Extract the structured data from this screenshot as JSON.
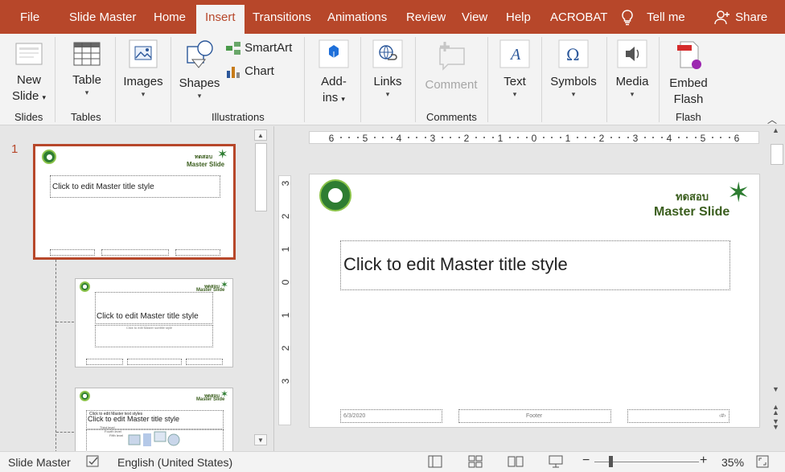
{
  "tabs": {
    "file": "File",
    "slide_master": "Slide Master",
    "home": "Home",
    "insert": "Insert",
    "transitions": "Transitions",
    "animations": "Animations",
    "review": "Review",
    "view": "View",
    "help": "Help",
    "acrobat": "ACROBAT",
    "tell_me": "Tell me",
    "share": "Share"
  },
  "ribbon": {
    "new_slide": "New",
    "new_slide2": "Slide",
    "table": "Table",
    "images": "Images",
    "shapes": "Shapes",
    "smartart": "SmartArt",
    "chart": "Chart",
    "addins": "Add-",
    "addins2": "ins",
    "links": "Links",
    "comment": "Comment",
    "text": "Text",
    "symbols": "Symbols",
    "media": "Media",
    "embed_flash": "Embed",
    "embed_flash2": "Flash",
    "groups": {
      "slides": "Slides",
      "tables": "Tables",
      "illustrations": "Illustrations",
      "comments": "Comments",
      "flash": "Flash"
    }
  },
  "thumbnails": {
    "number": "1",
    "thai": "ทดสอบ",
    "master_slide": "Master Slide",
    "title_text": "Click to edit Master title style",
    "subtitle_text": "Click to edit Master subtitle style",
    "text_styles": "Click to edit Master text styles",
    "third_level": "Third level",
    "fourth_level": "Fourth level",
    "fifth_level": "Fifth level"
  },
  "ruler": {
    "h": [
      "6",
      "5",
      "4",
      "3",
      "2",
      "1",
      "0",
      "1",
      "2",
      "3",
      "4",
      "5",
      "6"
    ],
    "v": [
      "3",
      "2",
      "1",
      "0",
      "1",
      "2",
      "3"
    ]
  },
  "slide": {
    "thai": "ทดสอบ",
    "master_slide": "Master Slide",
    "title": "Click to edit Master title style",
    "date": "6/3/2020",
    "footer": "Footer",
    "page_num": "‹#›"
  },
  "status": {
    "mode": "Slide Master",
    "language": "English (United States)",
    "zoom": "35%"
  },
  "colors": {
    "accent": "#b7472a",
    "brand_green": "#3b5e1e"
  }
}
